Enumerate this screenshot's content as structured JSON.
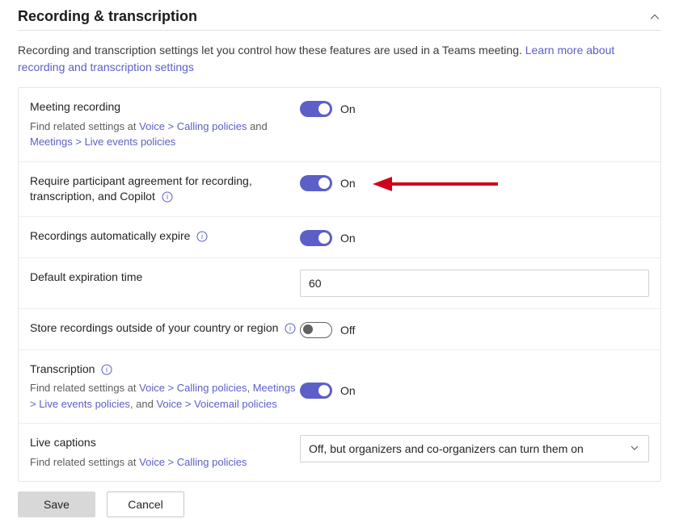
{
  "section": {
    "title": "Recording & transcription",
    "intro_plain": "Recording and transcription settings let you control how these features are used in a Teams meeting. ",
    "intro_link": "Learn more about recording and transcription settings"
  },
  "toggle_states": {
    "on": "On",
    "off": "Off"
  },
  "settings": {
    "meeting_recording": {
      "label": "Meeting recording",
      "sub_prefix": "Find related settings at ",
      "link1": "Voice > Calling policies",
      "mid": " and ",
      "link2": "Meetings > Live events policies",
      "state": "On"
    },
    "participant_agreement": {
      "label": "Require participant agreement for recording, transcription, and Copilot",
      "state": "On"
    },
    "auto_expire": {
      "label": "Recordings automatically expire",
      "state": "On"
    },
    "default_expiration": {
      "label": "Default expiration time",
      "value": "60"
    },
    "store_outside": {
      "label": "Store recordings outside of your country or region",
      "state": "Off"
    },
    "transcription": {
      "label": "Transcription",
      "sub_prefix": "Find related settings at ",
      "link1": "Voice > Calling policies",
      "mid1": ", ",
      "link2": "Meetings > Live events policies",
      "mid2": ", and ",
      "link3": "Voice > Voicemail policies",
      "state": "On"
    },
    "live_captions": {
      "label": "Live captions",
      "sub_prefix": "Find related settings at ",
      "link1": "Voice > Calling policies",
      "value": "Off, but organizers and co-organizers can turn them on"
    }
  },
  "footer": {
    "save": "Save",
    "cancel": "Cancel"
  },
  "annotation": {
    "arrow_color": "#d0021b"
  }
}
